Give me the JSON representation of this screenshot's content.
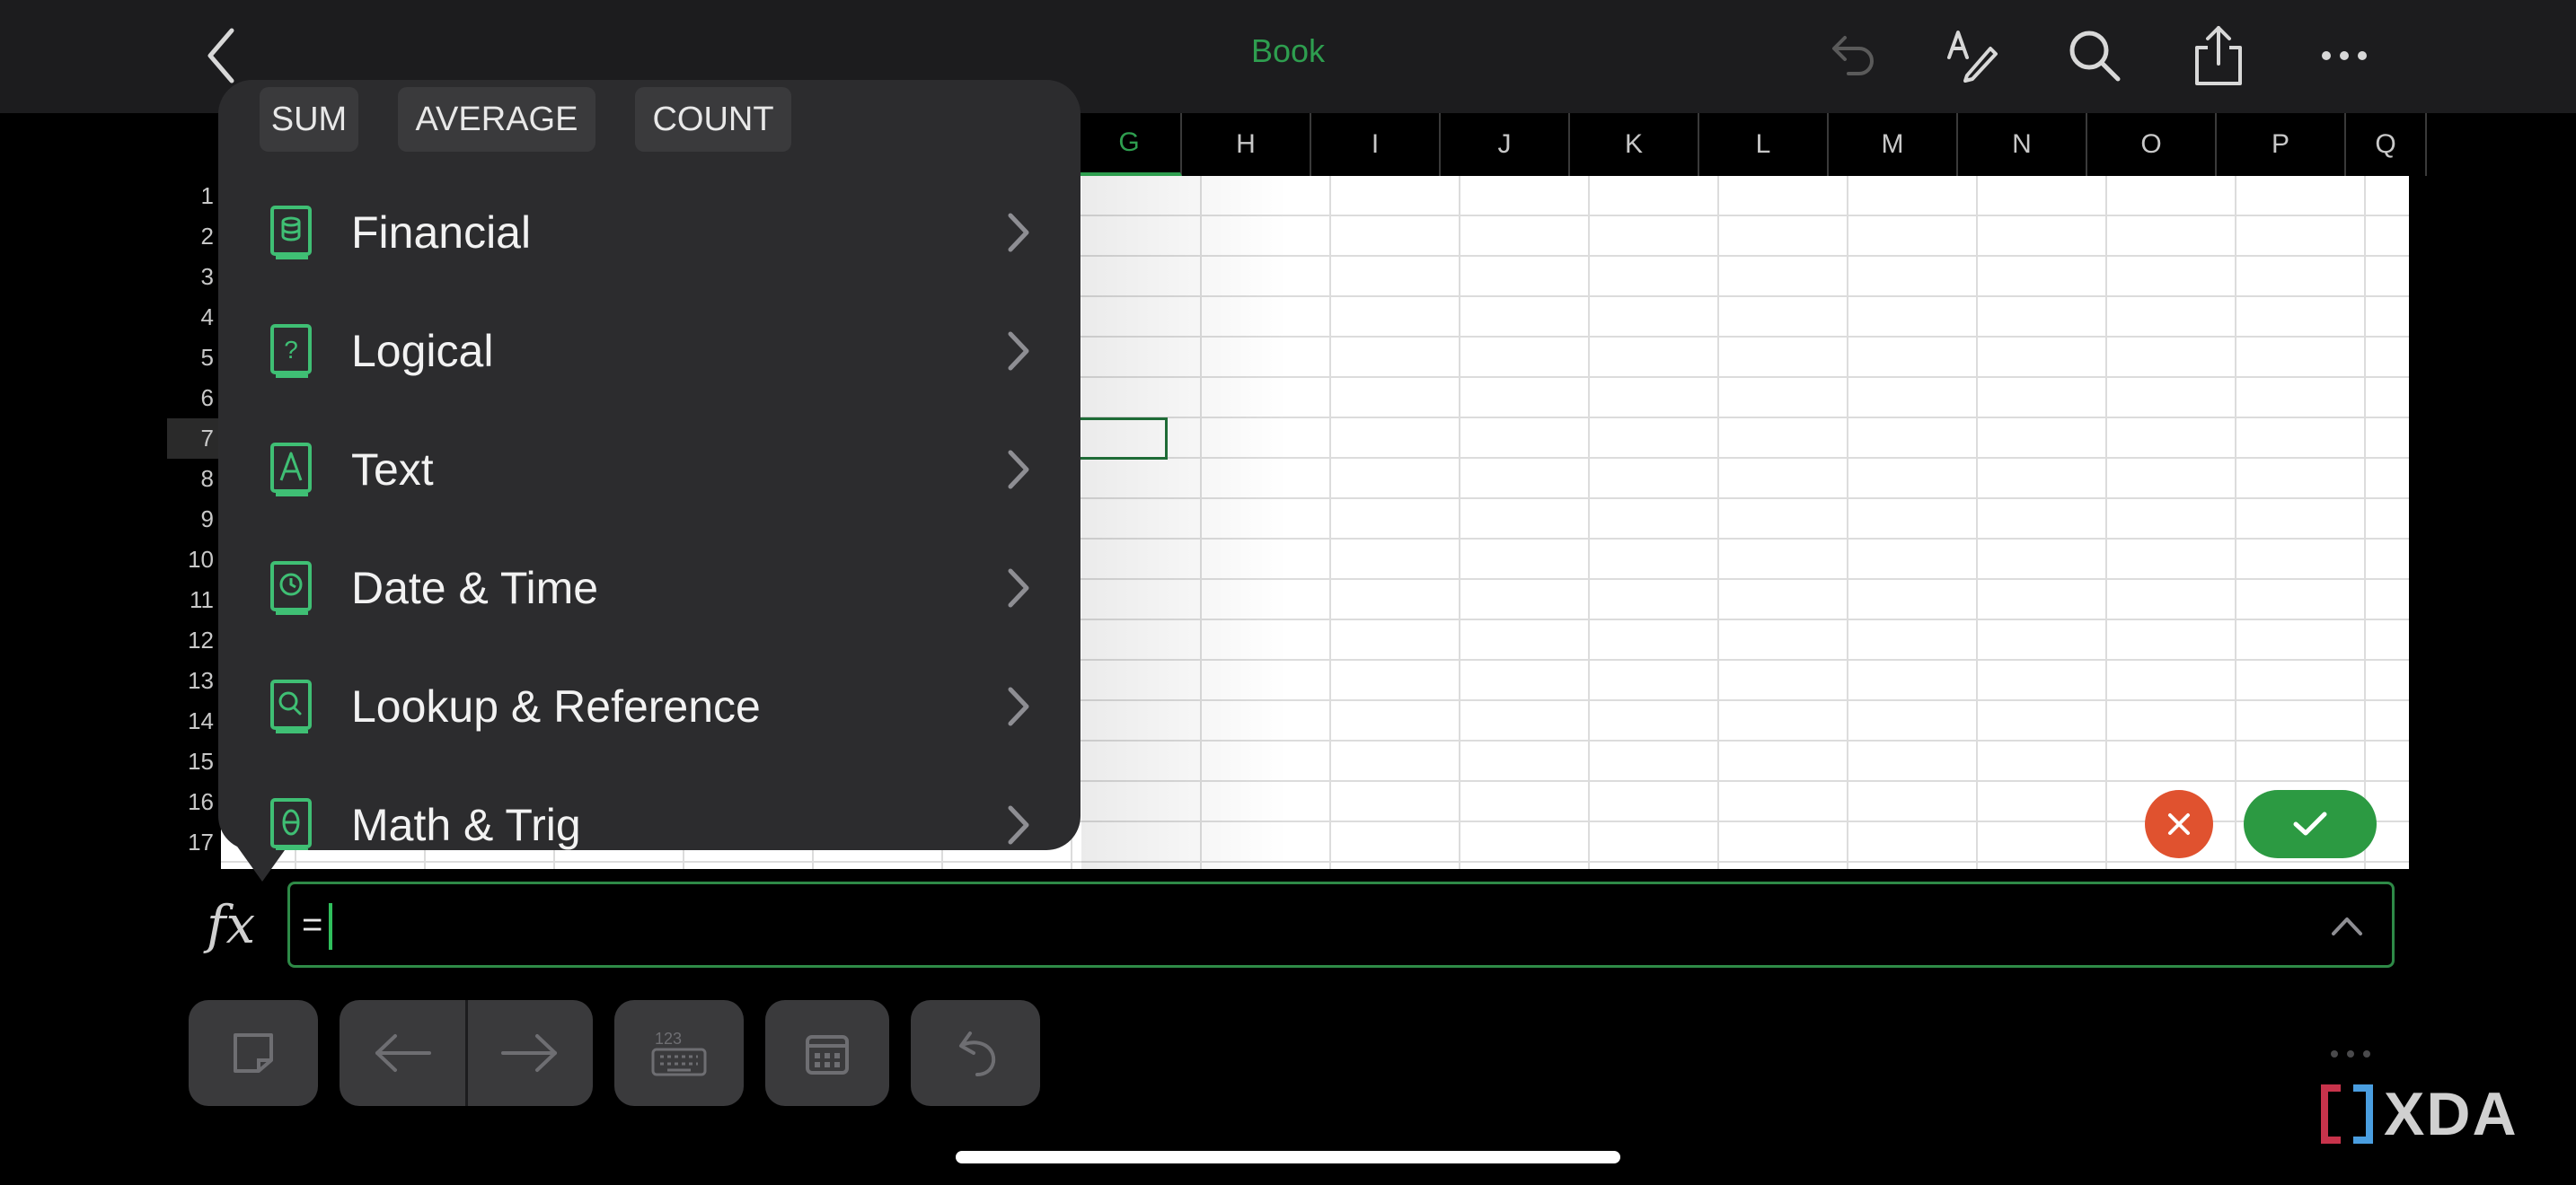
{
  "app": {
    "title": "Book"
  },
  "columns": [
    "G",
    "H",
    "I",
    "J",
    "K",
    "L",
    "M",
    "N",
    "O",
    "P",
    "Q"
  ],
  "rows": [
    "1",
    "2",
    "3",
    "4",
    "5",
    "6",
    "7",
    "8",
    "9",
    "10",
    "11",
    "12",
    "13",
    "14",
    "15",
    "16",
    "17"
  ],
  "quick_functions": [
    "SUM",
    "AVERAGE",
    "COUNT"
  ],
  "categories": [
    {
      "label": "Financial",
      "icon": "financial-icon"
    },
    {
      "label": "Logical",
      "icon": "logical-icon"
    },
    {
      "label": "Text",
      "icon": "text-icon"
    },
    {
      "label": "Date & Time",
      "icon": "date-time-icon"
    },
    {
      "label": "Lookup & Reference",
      "icon": "lookup-reference-icon"
    },
    {
      "label": "Math & Trig",
      "icon": "math-trig-icon"
    }
  ],
  "formula_bar": {
    "value": "="
  },
  "watermark": "XDA",
  "colors": {
    "accent": "#2e9e4f",
    "cancel": "#e0522f",
    "confirm": "#2c9a42"
  }
}
